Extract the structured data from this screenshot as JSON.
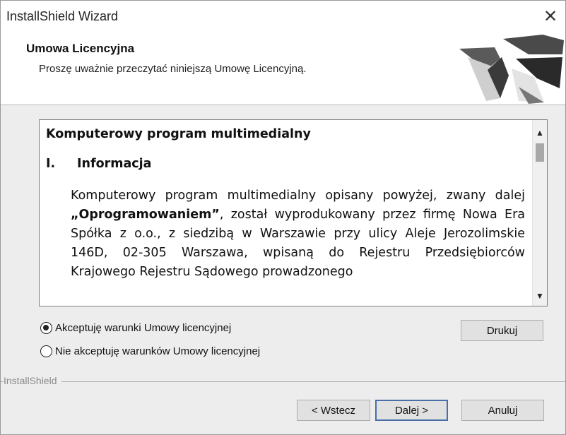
{
  "window": {
    "title": "InstallShield Wizard",
    "close_glyph": "✕"
  },
  "header": {
    "title": "Umowa Licencyjna",
    "subtitle": "Proszę uważnie przeczytać niniejszą Umowę Licencyjną.",
    "logo_icon": "installshield-logo-icon"
  },
  "license": {
    "heading": "Komputerowy program multimedialny",
    "section_number": "I.",
    "section_title": "Informacja",
    "paragraph_parts": {
      "before": "Komputerowy program multimedialny opisany powyżej, zwany dalej ",
      "bold": "„Oprogramowaniem”",
      "after": ", został wyprodukowany przez firmę Nowa Era Spółka z o.o., z siedzibą w Warszawie przy ulicy Aleje Jerozolimskie 146D, 02-305 Warszawa, wpisaną do Rejestru Przedsiębiorców Krajowego Rejestru Sądowego prowadzonego"
    },
    "scroll_up_glyph": "▲",
    "scroll_down_glyph": "▼"
  },
  "options": {
    "accept_label": "Akceptuję warunki Umowy licencyjnej",
    "decline_label": "Nie akceptuję warunków Umowy licencyjnej",
    "selected": "accept"
  },
  "buttons": {
    "print": "Drukuj",
    "back": "< Wstecz",
    "next": "Dalej >",
    "cancel": "Anuluj"
  },
  "footer": {
    "brand": "InstallShield"
  }
}
